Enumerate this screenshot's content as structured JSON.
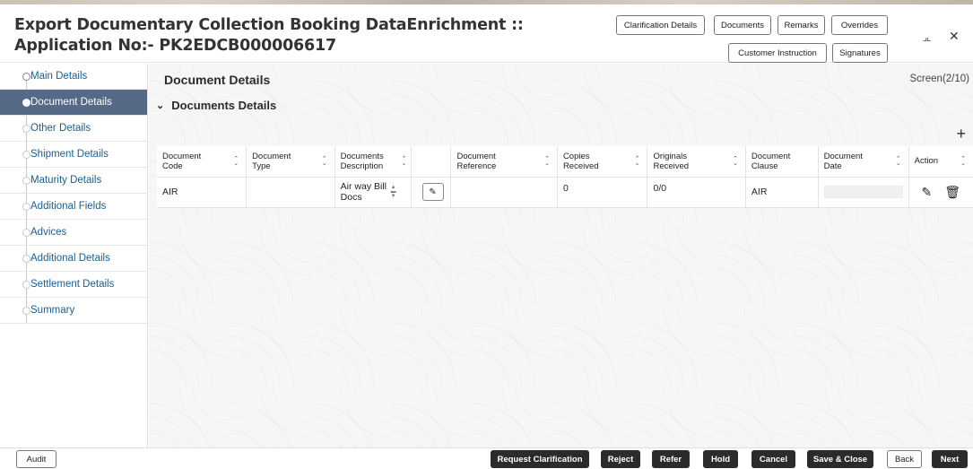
{
  "header": {
    "title": "Export Documentary Collection Booking DataEnrichment :: Application No:- PK2EDCB000006617",
    "buttons": {
      "clarification": "Clarification Details",
      "documents": "Documents",
      "remarks": "Remarks",
      "overrides": "Overrides",
      "customer_instruction": "Customer Instruction",
      "signatures": "Signatures"
    },
    "window_controls": {
      "collapse": "⌟⌞",
      "close": "✕"
    }
  },
  "sidebar": {
    "items": [
      {
        "label": "Main Details",
        "state": "done"
      },
      {
        "label": "Document Details",
        "state": "current"
      },
      {
        "label": "Other Details",
        "state": "pending"
      },
      {
        "label": "Shipment Details",
        "state": "pending"
      },
      {
        "label": "Maturity Details",
        "state": "pending"
      },
      {
        "label": "Additional Fields",
        "state": "pending"
      },
      {
        "label": "Advices",
        "state": "pending"
      },
      {
        "label": "Additional Details",
        "state": "pending"
      },
      {
        "label": "Settlement Details",
        "state": "pending"
      },
      {
        "label": "Summary",
        "state": "pending"
      }
    ]
  },
  "main": {
    "section_title": "Document Details",
    "screen_no": "Screen(2/10)",
    "subsection_title": "Documents Details",
    "add_icon": "+",
    "table": {
      "headers": [
        "Document Code",
        "Document Type",
        "Documents Description",
        "",
        "Document Reference",
        "Copies Received",
        "Originals Received",
        "Document Clause",
        "Document Date",
        "Action"
      ],
      "rows": [
        {
          "code": "AIR",
          "type": "",
          "description": "Air way Bill Docs",
          "reference": "",
          "copies": "0",
          "originals": "0/0",
          "clause": "AIR",
          "date": ""
        }
      ]
    }
  },
  "footer": {
    "audit": "Audit",
    "request_clarification": "Request Clarification",
    "reject": "Reject",
    "refer": "Refer",
    "hold": "Hold",
    "cancel": "Cancel",
    "save_close": "Save & Close",
    "back": "Back",
    "next": "Next"
  },
  "colors": {
    "active_nav": "#556a86",
    "link": "#1a73c8",
    "dark_button": "#2b2b2b"
  }
}
